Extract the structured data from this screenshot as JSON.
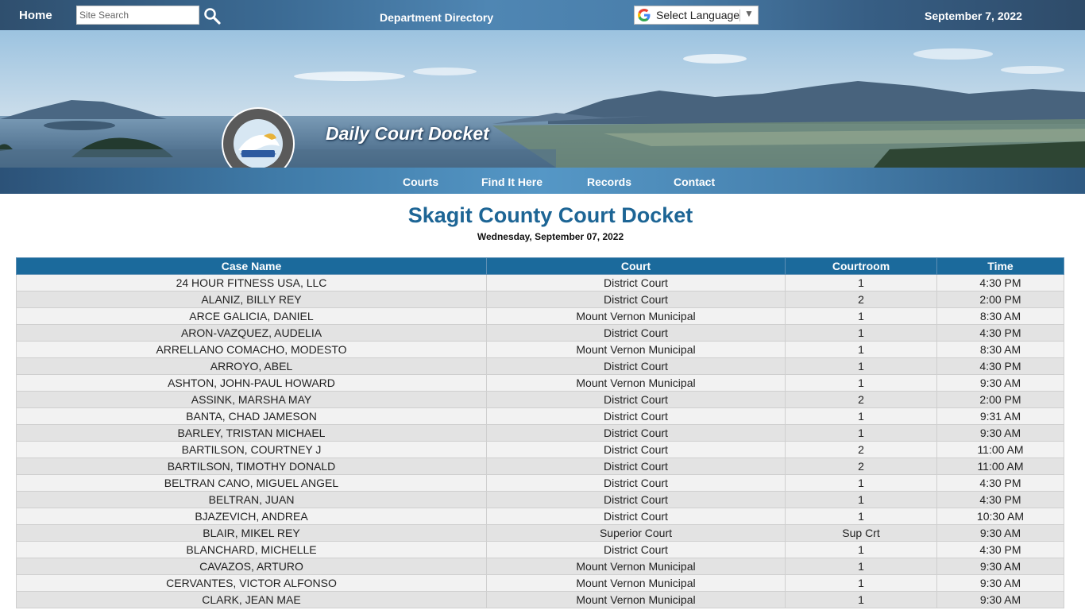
{
  "header": {
    "home_label": "Home",
    "search_placeholder": "Site Search",
    "department_directory_label": "Department Directory",
    "language_label": "Select Language",
    "date": "September 7, 2022"
  },
  "banner": {
    "title": "Daily Court Docket",
    "seal_alt": "Skagit County Washington - Serving With Pride"
  },
  "nav": {
    "items": [
      {
        "label": "Courts"
      },
      {
        "label": "Find It Here"
      },
      {
        "label": "Records"
      },
      {
        "label": "Contact"
      }
    ]
  },
  "page": {
    "title": "Skagit County Court Docket",
    "date": "Wednesday, September 07, 2022"
  },
  "table": {
    "headers": [
      "Case Name",
      "Court",
      "Courtroom",
      "Time"
    ],
    "rows": [
      [
        "24 HOUR FITNESS USA, LLC",
        "District Court",
        "1",
        "4:30 PM"
      ],
      [
        "ALANIZ, BILLY REY",
        "District Court",
        "2",
        "2:00 PM"
      ],
      [
        "ARCE GALICIA, DANIEL",
        "Mount Vernon Municipal",
        "1",
        "8:30 AM"
      ],
      [
        "ARON-VAZQUEZ, AUDELIA",
        "District Court",
        "1",
        "4:30 PM"
      ],
      [
        "ARRELLANO COMACHO, MODESTO",
        "Mount Vernon Municipal",
        "1",
        "8:30 AM"
      ],
      [
        "ARROYO, ABEL",
        "District Court",
        "1",
        "4:30 PM"
      ],
      [
        "ASHTON, JOHN-PAUL HOWARD",
        "Mount Vernon Municipal",
        "1",
        "9:30 AM"
      ],
      [
        "ASSINK, MARSHA MAY",
        "District Court",
        "2",
        "2:00 PM"
      ],
      [
        "BANTA, CHAD JAMESON",
        "District Court",
        "1",
        "9:31 AM"
      ],
      [
        "BARLEY, TRISTAN MICHAEL",
        "District Court",
        "1",
        "9:30 AM"
      ],
      [
        "BARTILSON, COURTNEY J",
        "District Court",
        "2",
        "11:00 AM"
      ],
      [
        "BARTILSON, TIMOTHY DONALD",
        "District Court",
        "2",
        "11:00 AM"
      ],
      [
        "BELTRAN CANO, MIGUEL ANGEL",
        "District Court",
        "1",
        "4:30 PM"
      ],
      [
        "BELTRAN, JUAN",
        "District Court",
        "1",
        "4:30 PM"
      ],
      [
        "BJAZEVICH, ANDREA",
        "District Court",
        "1",
        "10:30 AM"
      ],
      [
        "BLAIR, MIKEL REY",
        "Superior Court",
        "Sup Crt",
        "9:30 AM"
      ],
      [
        "BLANCHARD, MICHELLE",
        "District Court",
        "1",
        "4:30 PM"
      ],
      [
        "CAVAZOS, ARTURO",
        "Mount Vernon Municipal",
        "1",
        "9:30 AM"
      ],
      [
        "CERVANTES, VICTOR ALFONSO",
        "Mount Vernon Municipal",
        "1",
        "9:30 AM"
      ],
      [
        "CLARK, JEAN MAE",
        "Mount Vernon Municipal",
        "1",
        "9:30 AM"
      ]
    ]
  }
}
